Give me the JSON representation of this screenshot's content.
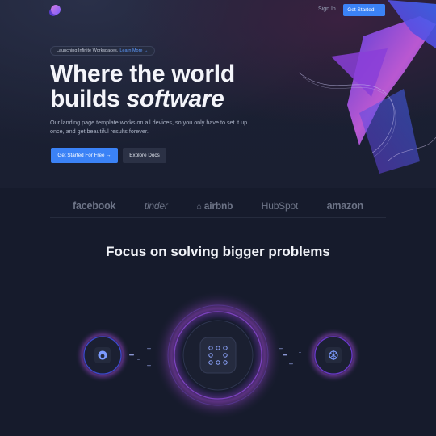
{
  "nav": {
    "signin_label": "Sign In",
    "get_started_label": "Get Started →"
  },
  "hero": {
    "pill_text": "Launching Infinite Workspaces.",
    "pill_link": "Learn More →",
    "title_line1": "Where the world",
    "title_line2_plain": "builds ",
    "title_line2_italic": "software",
    "subtitle": "Our landing page template works on all devices, so you only have to set it up once, and get beautiful results forever.",
    "cta_primary": "Get Started For Free →",
    "cta_secondary": "Explore Docs"
  },
  "logos": [
    "facebook",
    "tinder",
    "airbnb",
    "HubSpot",
    "amazon"
  ],
  "section": {
    "title": "Focus on solving bigger problems"
  },
  "icons": {
    "left": "github-icon",
    "center": "grid-dots-icon",
    "right": "openai-icon"
  },
  "colors": {
    "accent": "#3b82f6",
    "background": "#151a2b",
    "purple": "#8b3dff",
    "pink": "#e05ad6"
  }
}
